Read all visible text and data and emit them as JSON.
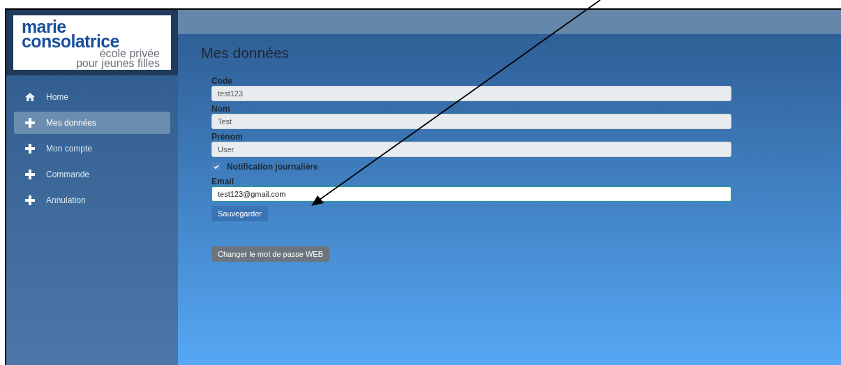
{
  "logo": {
    "name_lines": [
      "marie",
      "consolatrice"
    ],
    "tagline_lines": [
      "école privée",
      "pour jeunes filles"
    ]
  },
  "sidebar": {
    "items": [
      {
        "label": "Home",
        "kind": "home",
        "selected": false
      },
      {
        "label": "Mes données",
        "kind": "plus",
        "selected": true
      },
      {
        "label": "Mon compte",
        "kind": "plus",
        "selected": false
      },
      {
        "label": "Commande",
        "kind": "plus",
        "selected": false
      },
      {
        "label": "Annulation",
        "kind": "plus",
        "selected": false
      }
    ]
  },
  "page_title": "Mes données",
  "fields": [
    {
      "label": "Code",
      "value": "test123",
      "disabled": true
    },
    {
      "label": "Nom",
      "value": "Test",
      "disabled": true
    },
    {
      "label": "Prénom",
      "value": "User",
      "disabled": true
    }
  ],
  "notification": {
    "label": "Notification journalière",
    "checked": true
  },
  "email": {
    "label": "Email",
    "value": "test123@gmail.com",
    "disabled": false
  },
  "save_button": "Sauvegarder",
  "password_button": "Changer le mot de passe WEB"
}
